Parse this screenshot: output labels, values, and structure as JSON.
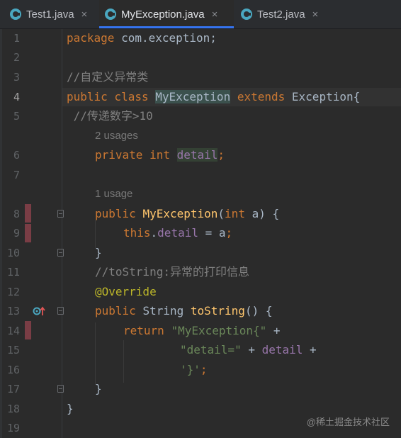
{
  "tabs": [
    {
      "label": "Test1.java",
      "active": false
    },
    {
      "label": "MyException.java",
      "active": true
    },
    {
      "label": "Test2.java",
      "active": false
    }
  ],
  "close_glyph": "×",
  "line_numbers": [
    "1",
    "2",
    "3",
    "4",
    "5",
    "6",
    "7",
    "8",
    "9",
    "10",
    "11",
    "12",
    "13",
    "14",
    "15",
    "16",
    "17",
    "18",
    "19"
  ],
  "code": {
    "l1_kw": "package",
    "l1_rest": " com.exception;",
    "l3": "//自定义异常类",
    "l4_kw": "public class ",
    "l4_name": "MyException",
    "l4_kw2": " extends ",
    "l4_rest": "Exception{",
    "l5": " //传递数字>10",
    "hint6": "2 usages",
    "l6_kw": "private int ",
    "l6_field": "detail",
    "l6_end": ";",
    "hint8": "1 usage",
    "l8_kw": "public ",
    "l8_fn": "MyException",
    "l8_p1": "(",
    "l8_kw2": "int",
    "l8_p2": " a) {",
    "l9_kw": "this",
    "l9_dot": ".",
    "l9_field": "detail",
    "l9_rest": " = a",
    "l9_semi": ";",
    "l10": "}",
    "l11": "//toString:异常的打印信息",
    "l12": "@Override",
    "l13_kw": "public ",
    "l13_type": "String ",
    "l13_fn": "toString",
    "l13_rest": "() {",
    "l14_kw": "return ",
    "l14_str": "\"MyException{\"",
    "l14_rest": " +",
    "l15_str": "\"detail=\"",
    "l15_op": " + ",
    "l15_field": "detail",
    "l15_rest": " +",
    "l16_str": "'}'",
    "l16_semi": ";",
    "l17": "}",
    "l18": "}"
  },
  "watermark": "@稀土掘金技术社区",
  "colors": {
    "keyword": "#cc7832",
    "comment": "#808080",
    "method": "#ffc66d",
    "string": "#6a8759",
    "field": "#9876aa",
    "annotation": "#bbb529"
  }
}
